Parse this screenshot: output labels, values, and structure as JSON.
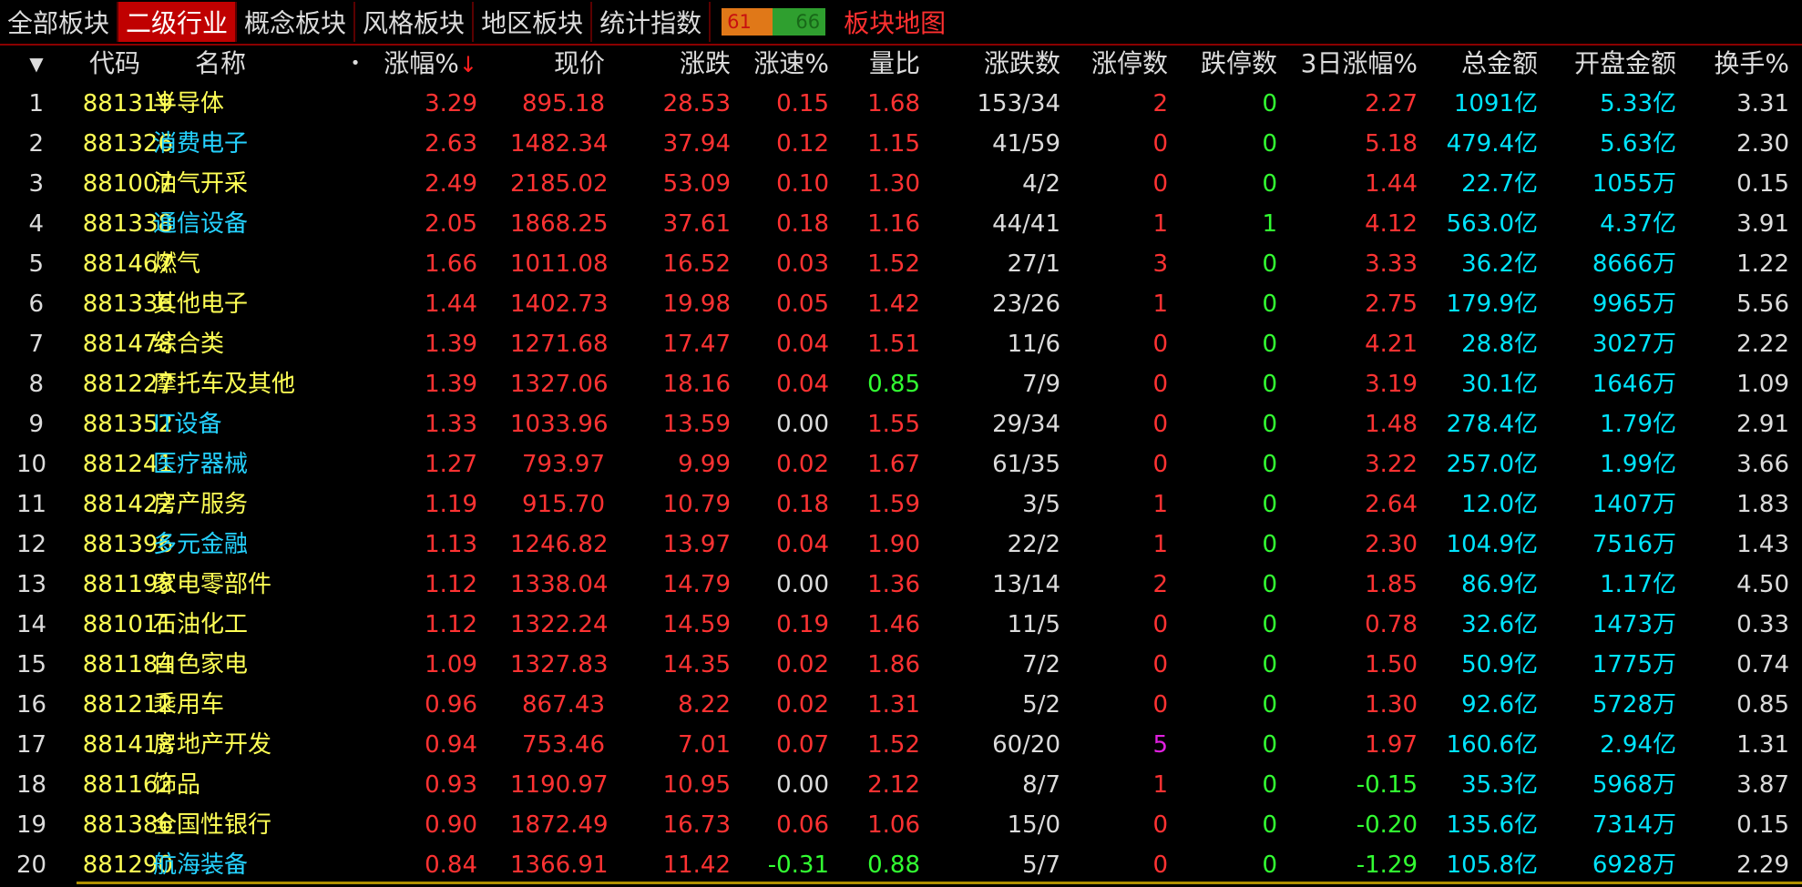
{
  "tabs": [
    {
      "label": "全部板块",
      "active": false
    },
    {
      "label": "二级行业",
      "active": true
    },
    {
      "label": "概念板块",
      "active": false
    },
    {
      "label": "风格板块",
      "active": false
    },
    {
      "label": "地区板块",
      "active": false
    },
    {
      "label": "统计指数",
      "active": false
    }
  ],
  "ratio": {
    "up": "61",
    "down": "66"
  },
  "map_link": "板块地图",
  "headers": {
    "menu": "▼",
    "code": "代码",
    "name": "名称",
    "dot": "•",
    "change_pct": "涨幅%",
    "sort_arrow": "↓",
    "price": "现价",
    "change": "涨跌",
    "speed": "涨速%",
    "vol_ratio": "量比",
    "updown": "涨跌数",
    "limit_up": "涨停数",
    "limit_down": "跌停数",
    "chg3d": "3日涨幅%",
    "amount": "总金额",
    "open_amount": "开盘金额",
    "turnover": "换手%"
  },
  "colors": {
    "up": "#ff3232",
    "down": "#32ff32",
    "code": "#ffff55",
    "amount": "#00e5ff",
    "active_tab": "#c00000"
  },
  "rows": [
    {
      "idx": "1",
      "code": "881319",
      "name": "半导体",
      "nc": "y",
      "pct": "3.29",
      "price": "895.18",
      "chg": "28.53",
      "spd": "0.15",
      "vr": "1.68",
      "vrd": 0,
      "ud": "153/34",
      "lu": "2",
      "ld": "0",
      "c3": "2.27",
      "c3d": 0,
      "amt": "1091亿",
      "oa": "5.33亿",
      "to": "3.31"
    },
    {
      "idx": "2",
      "code": "881326",
      "name": "消费电子",
      "nc": "c",
      "pct": "2.63",
      "price": "1482.34",
      "chg": "37.94",
      "spd": "0.12",
      "vr": "1.15",
      "vrd": 0,
      "ud": "41/59",
      "lu": "0",
      "ld": "0",
      "c3": "5.18",
      "c3d": 0,
      "amt": "479.4亿",
      "oa": "5.63亿",
      "to": "2.30"
    },
    {
      "idx": "3",
      "code": "881007",
      "name": "油气开采",
      "nc": "y",
      "pct": "2.49",
      "price": "2185.02",
      "chg": "53.09",
      "spd": "0.10",
      "vr": "1.30",
      "vrd": 0,
      "ud": "4/2",
      "lu": "0",
      "ld": "0",
      "c3": "1.44",
      "c3d": 0,
      "amt": "22.7亿",
      "oa": "1055万",
      "to": "0.15"
    },
    {
      "idx": "4",
      "code": "881338",
      "name": "通信设备",
      "nc": "c",
      "pct": "2.05",
      "price": "1868.25",
      "chg": "37.61",
      "spd": "0.18",
      "vr": "1.16",
      "vrd": 0,
      "ud": "44/41",
      "lu": "1",
      "ld": "1",
      "c3": "4.12",
      "c3d": 0,
      "amt": "563.0亿",
      "oa": "4.37亿",
      "to": "3.91"
    },
    {
      "idx": "5",
      "code": "881467",
      "name": "燃气",
      "nc": "y",
      "pct": "1.66",
      "price": "1011.08",
      "chg": "16.52",
      "spd": "0.03",
      "vr": "1.52",
      "vrd": 0,
      "ud": "27/1",
      "lu": "3",
      "ld": "0",
      "c3": "3.33",
      "c3d": 0,
      "amt": "36.2亿",
      "oa": "8666万",
      "to": "1.22"
    },
    {
      "idx": "6",
      "code": "881336",
      "name": "其他电子",
      "nc": "y",
      "pct": "1.44",
      "price": "1402.73",
      "chg": "19.98",
      "spd": "0.05",
      "vr": "1.42",
      "vrd": 0,
      "ud": "23/26",
      "lu": "1",
      "ld": "0",
      "c3": "2.75",
      "c3d": 0,
      "amt": "179.9亿",
      "oa": "9965万",
      "to": "5.56"
    },
    {
      "idx": "7",
      "code": "881478",
      "name": "综合类",
      "nc": "y",
      "pct": "1.39",
      "price": "1271.68",
      "chg": "17.47",
      "spd": "0.04",
      "vr": "1.51",
      "vrd": 0,
      "ud": "11/6",
      "lu": "0",
      "ld": "0",
      "c3": "4.21",
      "c3d": 0,
      "amt": "28.8亿",
      "oa": "3027万",
      "to": "2.22"
    },
    {
      "idx": "8",
      "code": "881227",
      "name": "摩托车及其他",
      "nc": "y",
      "pct": "1.39",
      "price": "1327.06",
      "chg": "18.16",
      "spd": "0.04",
      "vr": "0.85",
      "vrd": 1,
      "ud": "7/9",
      "lu": "0",
      "ld": "0",
      "c3": "3.19",
      "c3d": 0,
      "amt": "30.1亿",
      "oa": "1646万",
      "to": "1.09"
    },
    {
      "idx": "9",
      "code": "881352",
      "name": "IT设备",
      "nc": "c",
      "pct": "1.33",
      "price": "1033.96",
      "chg": "13.59",
      "spd": "0.00",
      "vr": "1.55",
      "vrd": 0,
      "ud": "29/34",
      "lu": "0",
      "ld": "0",
      "c3": "1.48",
      "c3d": 0,
      "amt": "278.4亿",
      "oa": "1.79亿",
      "to": "2.91"
    },
    {
      "idx": "10",
      "code": "881241",
      "name": "医疗器械",
      "nc": "c",
      "pct": "1.27",
      "price": "793.97",
      "chg": "9.99",
      "spd": "0.02",
      "vr": "1.67",
      "vrd": 0,
      "ud": "61/35",
      "lu": "0",
      "ld": "0",
      "c3": "3.22",
      "c3d": 0,
      "amt": "257.0亿",
      "oa": "1.99亿",
      "to": "3.66"
    },
    {
      "idx": "11",
      "code": "881422",
      "name": "房产服务",
      "nc": "y",
      "pct": "1.19",
      "price": "915.70",
      "chg": "10.79",
      "spd": "0.18",
      "vr": "1.59",
      "vrd": 0,
      "ud": "3/5",
      "lu": "1",
      "ld": "0",
      "c3": "2.64",
      "c3d": 0,
      "amt": "12.0亿",
      "oa": "1407万",
      "to": "1.83"
    },
    {
      "idx": "12",
      "code": "881396",
      "name": "多元金融",
      "nc": "c",
      "pct": "1.13",
      "price": "1246.82",
      "chg": "13.97",
      "spd": "0.04",
      "vr": "1.90",
      "vrd": 0,
      "ud": "22/2",
      "lu": "1",
      "ld": "0",
      "c3": "2.30",
      "c3d": 0,
      "amt": "104.9亿",
      "oa": "7516万",
      "to": "1.43"
    },
    {
      "idx": "13",
      "code": "881198",
      "name": "家电零部件",
      "nc": "y",
      "pct": "1.12",
      "price": "1338.04",
      "chg": "14.79",
      "spd": "0.00",
      "vr": "1.36",
      "vrd": 0,
      "ud": "13/14",
      "lu": "2",
      "ld": "0",
      "c3": "1.85",
      "c3d": 0,
      "amt": "86.9亿",
      "oa": "1.17亿",
      "to": "4.50"
    },
    {
      "idx": "14",
      "code": "881011",
      "name": "石油化工",
      "nc": "y",
      "pct": "1.12",
      "price": "1322.24",
      "chg": "14.59",
      "spd": "0.19",
      "vr": "1.46",
      "vrd": 0,
      "ud": "11/5",
      "lu": "0",
      "ld": "0",
      "c3": "0.78",
      "c3d": 0,
      "amt": "32.6亿",
      "oa": "1473万",
      "to": "0.33"
    },
    {
      "idx": "15",
      "code": "881184",
      "name": "白色家电",
      "nc": "y",
      "pct": "1.09",
      "price": "1327.83",
      "chg": "14.35",
      "spd": "0.02",
      "vr": "1.86",
      "vrd": 0,
      "ud": "7/2",
      "lu": "0",
      "ld": "0",
      "c3": "1.50",
      "c3d": 0,
      "amt": "50.9亿",
      "oa": "1775万",
      "to": "0.74"
    },
    {
      "idx": "16",
      "code": "881212",
      "name": "乘用车",
      "nc": "y",
      "pct": "0.96",
      "price": "867.43",
      "chg": "8.22",
      "spd": "0.02",
      "vr": "1.31",
      "vrd": 0,
      "ud": "5/2",
      "lu": "0",
      "ld": "0",
      "c3": "1.30",
      "c3d": 0,
      "amt": "92.6亿",
      "oa": "5728万",
      "to": "0.85"
    },
    {
      "idx": "17",
      "code": "881418",
      "name": "房地产开发",
      "nc": "y",
      "pct": "0.94",
      "price": "753.46",
      "chg": "7.01",
      "spd": "0.07",
      "vr": "1.52",
      "vrd": 0,
      "ud": "60/20",
      "lu": "5",
      "ld": "0",
      "c3": "1.97",
      "c3d": 0,
      "amt": "160.6亿",
      "oa": "2.94亿",
      "to": "1.31"
    },
    {
      "idx": "18",
      "code": "881162",
      "name": "饰品",
      "nc": "y",
      "pct": "0.93",
      "price": "1190.97",
      "chg": "10.95",
      "spd": "0.00",
      "vr": "2.12",
      "vrd": 0,
      "ud": "8/7",
      "lu": "1",
      "ld": "0",
      "c3": "-0.15",
      "c3d": 1,
      "amt": "35.3亿",
      "oa": "5968万",
      "to": "3.87"
    },
    {
      "idx": "19",
      "code": "881386",
      "name": "全国性银行",
      "nc": "y",
      "pct": "0.90",
      "price": "1872.49",
      "chg": "16.73",
      "spd": "0.06",
      "vr": "1.06",
      "vrd": 0,
      "ud": "15/0",
      "lu": "0",
      "ld": "0",
      "c3": "-0.20",
      "c3d": 1,
      "amt": "135.6亿",
      "oa": "7314万",
      "to": "0.15"
    },
    {
      "idx": "20",
      "code": "881290",
      "name": "航海装备",
      "nc": "c",
      "pct": "0.84",
      "price": "1366.91",
      "chg": "11.42",
      "spd": "-0.31",
      "vr": "0.88",
      "vrd": 1,
      "ud": "5/7",
      "lu": "0",
      "ld": "0",
      "c3": "-1.29",
      "c3d": 1,
      "amt": "105.8亿",
      "oa": "6928万",
      "to": "2.29"
    }
  ]
}
